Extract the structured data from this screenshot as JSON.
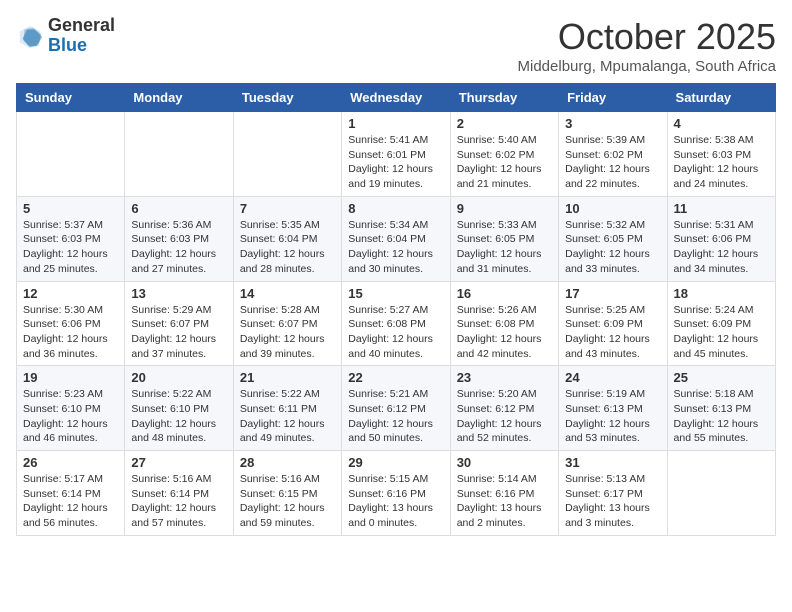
{
  "logo": {
    "general": "General",
    "blue": "Blue"
  },
  "header": {
    "title": "October 2025",
    "subtitle": "Middelburg, Mpumalanga, South Africa"
  },
  "days_of_week": [
    "Sunday",
    "Monday",
    "Tuesday",
    "Wednesday",
    "Thursday",
    "Friday",
    "Saturday"
  ],
  "weeks": [
    [
      {
        "day": "",
        "info": ""
      },
      {
        "day": "",
        "info": ""
      },
      {
        "day": "",
        "info": ""
      },
      {
        "day": "1",
        "info": "Sunrise: 5:41 AM\nSunset: 6:01 PM\nDaylight: 12 hours\nand 19 minutes."
      },
      {
        "day": "2",
        "info": "Sunrise: 5:40 AM\nSunset: 6:02 PM\nDaylight: 12 hours\nand 21 minutes."
      },
      {
        "day": "3",
        "info": "Sunrise: 5:39 AM\nSunset: 6:02 PM\nDaylight: 12 hours\nand 22 minutes."
      },
      {
        "day": "4",
        "info": "Sunrise: 5:38 AM\nSunset: 6:03 PM\nDaylight: 12 hours\nand 24 minutes."
      }
    ],
    [
      {
        "day": "5",
        "info": "Sunrise: 5:37 AM\nSunset: 6:03 PM\nDaylight: 12 hours\nand 25 minutes."
      },
      {
        "day": "6",
        "info": "Sunrise: 5:36 AM\nSunset: 6:03 PM\nDaylight: 12 hours\nand 27 minutes."
      },
      {
        "day": "7",
        "info": "Sunrise: 5:35 AM\nSunset: 6:04 PM\nDaylight: 12 hours\nand 28 minutes."
      },
      {
        "day": "8",
        "info": "Sunrise: 5:34 AM\nSunset: 6:04 PM\nDaylight: 12 hours\nand 30 minutes."
      },
      {
        "day": "9",
        "info": "Sunrise: 5:33 AM\nSunset: 6:05 PM\nDaylight: 12 hours\nand 31 minutes."
      },
      {
        "day": "10",
        "info": "Sunrise: 5:32 AM\nSunset: 6:05 PM\nDaylight: 12 hours\nand 33 minutes."
      },
      {
        "day": "11",
        "info": "Sunrise: 5:31 AM\nSunset: 6:06 PM\nDaylight: 12 hours\nand 34 minutes."
      }
    ],
    [
      {
        "day": "12",
        "info": "Sunrise: 5:30 AM\nSunset: 6:06 PM\nDaylight: 12 hours\nand 36 minutes."
      },
      {
        "day": "13",
        "info": "Sunrise: 5:29 AM\nSunset: 6:07 PM\nDaylight: 12 hours\nand 37 minutes."
      },
      {
        "day": "14",
        "info": "Sunrise: 5:28 AM\nSunset: 6:07 PM\nDaylight: 12 hours\nand 39 minutes."
      },
      {
        "day": "15",
        "info": "Sunrise: 5:27 AM\nSunset: 6:08 PM\nDaylight: 12 hours\nand 40 minutes."
      },
      {
        "day": "16",
        "info": "Sunrise: 5:26 AM\nSunset: 6:08 PM\nDaylight: 12 hours\nand 42 minutes."
      },
      {
        "day": "17",
        "info": "Sunrise: 5:25 AM\nSunset: 6:09 PM\nDaylight: 12 hours\nand 43 minutes."
      },
      {
        "day": "18",
        "info": "Sunrise: 5:24 AM\nSunset: 6:09 PM\nDaylight: 12 hours\nand 45 minutes."
      }
    ],
    [
      {
        "day": "19",
        "info": "Sunrise: 5:23 AM\nSunset: 6:10 PM\nDaylight: 12 hours\nand 46 minutes."
      },
      {
        "day": "20",
        "info": "Sunrise: 5:22 AM\nSunset: 6:10 PM\nDaylight: 12 hours\nand 48 minutes."
      },
      {
        "day": "21",
        "info": "Sunrise: 5:22 AM\nSunset: 6:11 PM\nDaylight: 12 hours\nand 49 minutes."
      },
      {
        "day": "22",
        "info": "Sunrise: 5:21 AM\nSunset: 6:12 PM\nDaylight: 12 hours\nand 50 minutes."
      },
      {
        "day": "23",
        "info": "Sunrise: 5:20 AM\nSunset: 6:12 PM\nDaylight: 12 hours\nand 52 minutes."
      },
      {
        "day": "24",
        "info": "Sunrise: 5:19 AM\nSunset: 6:13 PM\nDaylight: 12 hours\nand 53 minutes."
      },
      {
        "day": "25",
        "info": "Sunrise: 5:18 AM\nSunset: 6:13 PM\nDaylight: 12 hours\nand 55 minutes."
      }
    ],
    [
      {
        "day": "26",
        "info": "Sunrise: 5:17 AM\nSunset: 6:14 PM\nDaylight: 12 hours\nand 56 minutes."
      },
      {
        "day": "27",
        "info": "Sunrise: 5:16 AM\nSunset: 6:14 PM\nDaylight: 12 hours\nand 57 minutes."
      },
      {
        "day": "28",
        "info": "Sunrise: 5:16 AM\nSunset: 6:15 PM\nDaylight: 12 hours\nand 59 minutes."
      },
      {
        "day": "29",
        "info": "Sunrise: 5:15 AM\nSunset: 6:16 PM\nDaylight: 13 hours\nand 0 minutes."
      },
      {
        "day": "30",
        "info": "Sunrise: 5:14 AM\nSunset: 6:16 PM\nDaylight: 13 hours\nand 2 minutes."
      },
      {
        "day": "31",
        "info": "Sunrise: 5:13 AM\nSunset: 6:17 PM\nDaylight: 13 hours\nand 3 minutes."
      },
      {
        "day": "",
        "info": ""
      }
    ]
  ]
}
